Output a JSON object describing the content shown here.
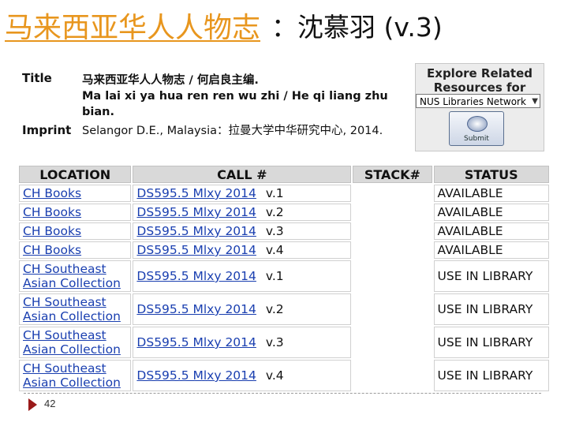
{
  "slide": {
    "title_link": "马来西亚华人人物志",
    "title_sep": "：",
    "title_name": "沈慕羽",
    "title_vol": "(v.3)"
  },
  "record": {
    "title_label": "Title",
    "title_zh": "马来西亚华人人物志 / 何启良主编.",
    "title_pinyin": "Ma lai xi ya hua ren ren wu zhi / He qi liang zhu bian.",
    "imprint_label": "Imprint",
    "imprint_value": "Selangor D.E., Malaysia：拉曼大学中华研究中心, 2014."
  },
  "explore": {
    "title": "Explore Related Resources for",
    "selected": "NUS Libraries Network",
    "submit_label": "Submit"
  },
  "holdings": {
    "headers": [
      "LOCATION",
      "CALL #",
      "STACK#",
      "STATUS"
    ],
    "rows": [
      {
        "loc1": "CH Books",
        "loc2": "",
        "call": "DS595.5 Mlxy 2014",
        "vol": "v.1",
        "stack": "",
        "status": "AVAILABLE"
      },
      {
        "loc1": "CH Books",
        "loc2": "",
        "call": "DS595.5 Mlxy 2014",
        "vol": "v.2",
        "stack": "",
        "status": "AVAILABLE"
      },
      {
        "loc1": "CH Books",
        "loc2": "",
        "call": "DS595.5 Mlxy 2014",
        "vol": "v.3",
        "stack": "",
        "status": "AVAILABLE"
      },
      {
        "loc1": "CH Books",
        "loc2": "",
        "call": "DS595.5 Mlxy 2014",
        "vol": "v.4",
        "stack": "",
        "status": "AVAILABLE"
      },
      {
        "loc1": "CH Southeast",
        "loc2": "Asian Collection",
        "call": "DS595.5 Mlxy 2014",
        "vol": "v.1",
        "stack": "",
        "status": "USE IN LIBRARY"
      },
      {
        "loc1": "CH Southeast",
        "loc2": "Asian Collection",
        "call": "DS595.5 Mlxy 2014",
        "vol": "v.2",
        "stack": "",
        "status": "USE IN LIBRARY"
      },
      {
        "loc1": "CH Southeast",
        "loc2": "Asian Collection",
        "call": "DS595.5 Mlxy 2014",
        "vol": "v.3",
        "stack": "",
        "status": "USE IN LIBRARY"
      },
      {
        "loc1": "CH Southeast",
        "loc2": "Asian Collection",
        "call": "DS595.5 Mlxy 2014",
        "vol": "v.4",
        "stack": "",
        "status": "USE IN LIBRARY"
      }
    ]
  },
  "footer": {
    "page_number": "42"
  },
  "colors": {
    "title_link": "#e8961e",
    "link": "#1a3fb0",
    "header_bg": "#d9d9d9",
    "page_arrow": "#9a1a1a"
  }
}
